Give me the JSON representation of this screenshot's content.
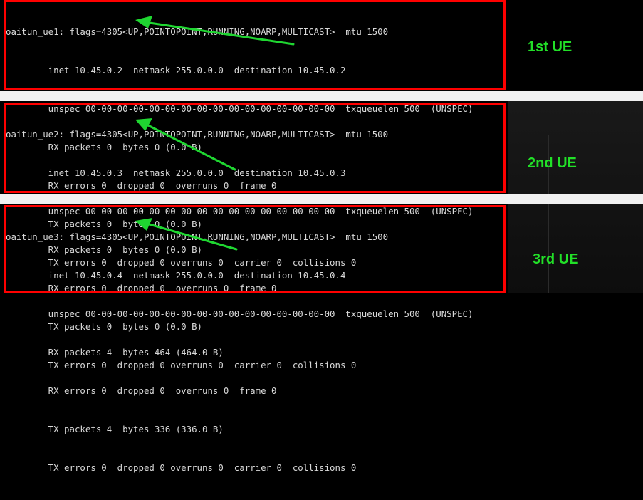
{
  "colors": {
    "highlight_box": "#ff0000",
    "annotation": "#22e028",
    "arrow": "#1fd631",
    "terminal_text": "#d8d8d8",
    "background": "#000000"
  },
  "interfaces": [
    {
      "lines": [
        "oaitun_ue1: flags=4305<UP,POINTOPOINT,RUNNING,NOARP,MULTICAST>  mtu 1500",
        "        inet 10.45.0.2  netmask 255.0.0.0  destination 10.45.0.2",
        "        unspec 00-00-00-00-00-00-00-00-00-00-00-00-00-00-00-00  txqueuelen 500  (UNSPEC)",
        "        RX packets 0  bytes 0 (0.0 B)",
        "        RX errors 0  dropped 0  overruns 0  frame 0",
        "        TX packets 0  bytes 0 (0.0 B)",
        "        TX errors 0  dropped 0 overruns 0  carrier 0  collisions 0"
      ],
      "label": "1st UE"
    },
    {
      "lines": [
        "oaitun_ue2: flags=4305<UP,POINTOPOINT,RUNNING,NOARP,MULTICAST>  mtu 1500",
        "        inet 10.45.0.3  netmask 255.0.0.0  destination 10.45.0.3",
        "        unspec 00-00-00-00-00-00-00-00-00-00-00-00-00-00-00-00  txqueuelen 500  (UNSPEC)",
        "        RX packets 0  bytes 0 (0.0 B)",
        "        RX errors 0  dropped 0  overruns 0  frame 0",
        "        TX packets 0  bytes 0 (0.0 B)",
        "        TX errors 0  dropped 0 overruns 0  carrier 0  collisions 0"
      ],
      "label": "2nd UE"
    },
    {
      "lines": [
        "oaitun_ue3: flags=4305<UP,POINTOPOINT,RUNNING,NOARP,MULTICAST>  mtu 1500",
        "        inet 10.45.0.4  netmask 255.0.0.0  destination 10.45.0.4",
        "        unspec 00-00-00-00-00-00-00-00-00-00-00-00-00-00-00-00  txqueuelen 500  (UNSPEC)",
        "        RX packets 4  bytes 464 (464.0 B)",
        "        RX errors 0  dropped 0  overruns 0  frame 0",
        "        TX packets 4  bytes 336 (336.0 B)",
        "        TX errors 0  dropped 0 overruns 0  carrier 0  collisions 0"
      ],
      "label": "3rd UE"
    }
  ]
}
